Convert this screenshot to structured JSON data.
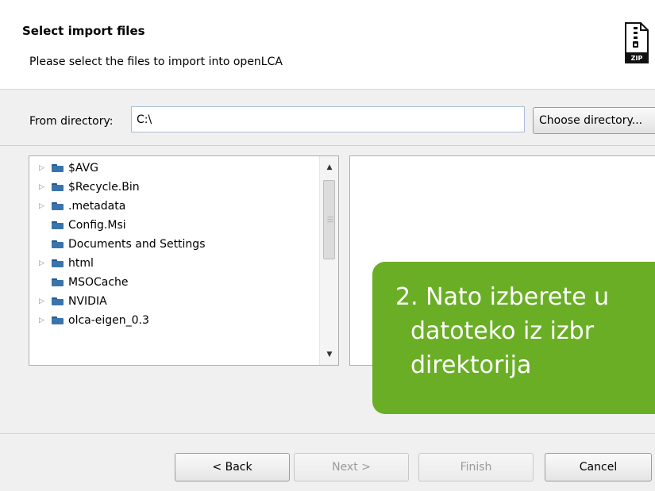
{
  "header": {
    "title": "Select import files",
    "subtitle": "Please select the files to import into openLCA",
    "icon": "zip-file-icon",
    "icon_text": "ZIP"
  },
  "directory": {
    "label": "From directory:",
    "value": "C:\\",
    "choose_button": "Choose directory..."
  },
  "tree": {
    "items": [
      {
        "label": "$AVG",
        "expandable": true
      },
      {
        "label": "$Recycle.Bin",
        "expandable": true
      },
      {
        "label": ".metadata",
        "expandable": true
      },
      {
        "label": "Config.Msi",
        "expandable": false
      },
      {
        "label": "Documents and Settings",
        "expandable": false
      },
      {
        "label": "html",
        "expandable": true
      },
      {
        "label": "MSOCache",
        "expandable": false
      },
      {
        "label": "NVIDIA",
        "expandable": true
      },
      {
        "label": "olca-eigen_0.3",
        "expandable": true
      }
    ]
  },
  "callout": {
    "line1": "2. Nato izberete u",
    "line2": "datoteko iz izbr",
    "line3": "direktorija"
  },
  "buttons": {
    "back": "< Back",
    "next": "Next >",
    "finish": "Finish",
    "cancel": "Cancel"
  },
  "colors": {
    "callout": "#6aae26",
    "folder": "#3a74ad"
  }
}
